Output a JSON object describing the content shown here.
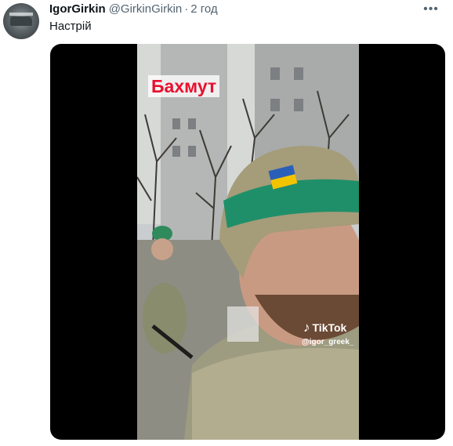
{
  "tweet": {
    "author_name": "IgorGirkin",
    "author_handle": "@GirkinGirkin",
    "separator": "·",
    "time": "2 год",
    "text": "Настрій"
  },
  "media": {
    "overlay_title": "Бахмут",
    "tiktok_brand": "TikTok",
    "tiktok_user": "@igor_greek_"
  },
  "icons": {
    "more": "more-horizontal-icon",
    "tiktok": "tiktok-note-icon"
  },
  "colors": {
    "title_red": "#e8102f",
    "text_primary": "#0f1419",
    "text_secondary": "#536471",
    "helmet_tape": "#1f8f6a"
  }
}
